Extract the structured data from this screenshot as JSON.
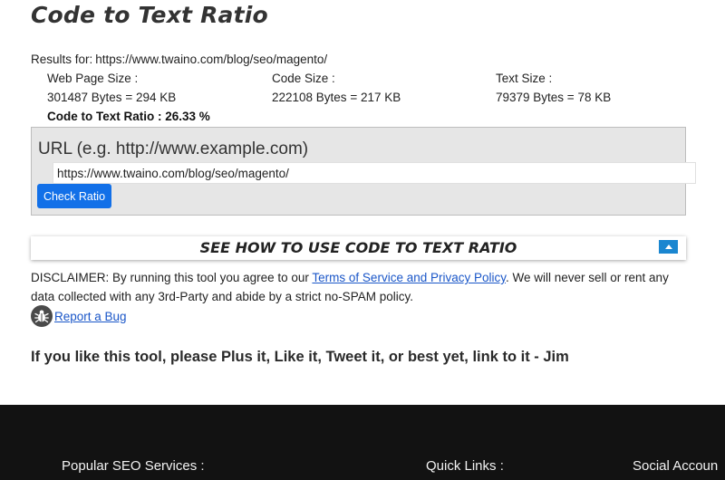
{
  "page": {
    "title": "Code to Text Ratio"
  },
  "results": {
    "prefix": "Results for:",
    "url": "https://www.twaino.com/blog/seo/magento/",
    "web_page_size": {
      "label": "Web Page Size :",
      "value": "301487 Bytes = 294 KB"
    },
    "code_size": {
      "label": "Code Size :",
      "value": "222108 Bytes = 217 KB"
    },
    "text_size": {
      "label": "Text Size :",
      "value": "79379 Bytes = 78 KB"
    },
    "ratio": "Code to Text Ratio : 26.33 %"
  },
  "form": {
    "label": "URL (e.g. http://www.example.com)",
    "url_value": "https://www.twaino.com/blog/seo/magento/",
    "submit_label": "Check Ratio"
  },
  "howto": {
    "label": "SEE HOW TO USE CODE TO TEXT RATIO",
    "toggle_icon": "chevron-up-icon"
  },
  "disclaimer": {
    "before": "DISCLAIMER: By running this tool you agree to our ",
    "link": "Terms of Service and Privacy Policy",
    "after": ". We will never sell or rent any data collected with any 3rd-Party and abide by a strict no-SPAM policy."
  },
  "bug_report": {
    "icon": "bug-icon",
    "link": "Report a Bug"
  },
  "plug": "If you like this tool, please Plus it, Like it, Tweet it, or best yet, link to it - Jim",
  "footer": {
    "popular_seo": "Popular SEO Services :",
    "quick_links": "Quick Links :",
    "social": "Social Accoun"
  },
  "colors": {
    "accent": "#1270e8",
    "toggle": "#1a86d0",
    "link": "#1a56c8",
    "footer_bg": "#121212",
    "form_bg": "#e6e6e6"
  }
}
